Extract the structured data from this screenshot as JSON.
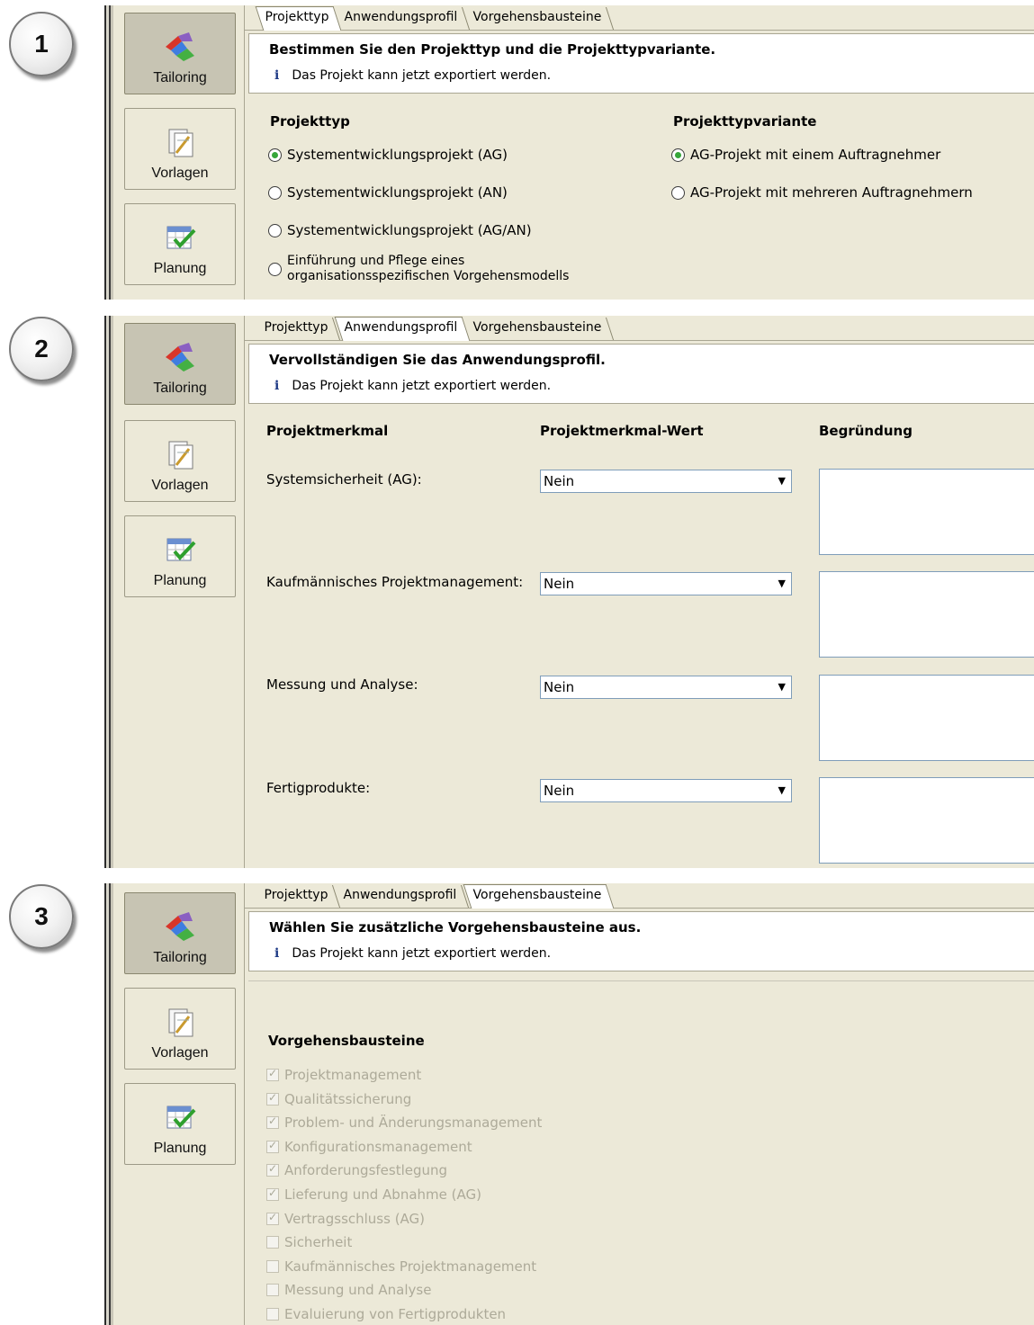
{
  "steps": [
    {
      "number": "1"
    },
    {
      "number": "2"
    },
    {
      "number": "3"
    }
  ],
  "sidebar": {
    "tailoring_label": "Tailoring",
    "vorlagen_label": "Vorlagen",
    "planung_label": "Planung"
  },
  "tabs": [
    "Projekttyp",
    "Anwendungsprofil",
    "Vorgehensbausteine"
  ],
  "info_message": "Das Projekt kann jetzt exportiert werden.",
  "info_icon": "i",
  "panel1": {
    "title": "Bestimmen Sie den Projekttyp und die Projekttypvariante.",
    "projekttyp_heading": "Projekttyp",
    "variante_heading": "Projekttypvariante",
    "projekttyp_options": [
      {
        "label": "Systementwicklungsprojekt (AG)",
        "selected": true
      },
      {
        "label": "Systementwicklungsprojekt (AN)",
        "selected": false
      },
      {
        "label": "Systementwicklungsprojekt (AG/AN)",
        "selected": false
      },
      {
        "label_line1": "Einführung und Pflege eines",
        "label_line2": "organisationsspezifischen Vorgehensmodells",
        "selected": false
      }
    ],
    "variante_options": [
      {
        "label": "AG-Projekt mit einem Auftragnehmer",
        "selected": true
      },
      {
        "label": "AG-Projekt mit mehreren Auftragnehmern",
        "selected": false
      }
    ]
  },
  "panel2": {
    "title": "Vervollständigen Sie das Anwendungsprofil.",
    "col_merkmal": "Projektmerkmal",
    "col_wert": "Projektmerkmal-Wert",
    "col_begruendung": "Begründung",
    "rows": [
      {
        "label": "Systemsicherheit (AG):",
        "value": "Nein"
      },
      {
        "label": "Kaufmännisches Projektmanagement:",
        "value": "Nein"
      },
      {
        "label": "Messung und Analyse:",
        "value": "Nein"
      },
      {
        "label": "Fertigprodukte:",
        "value": "Nein"
      }
    ]
  },
  "panel3": {
    "title": "Wählen Sie zusätzliche Vorgehensbausteine aus.",
    "section_heading": "Vorgehensbausteine",
    "items": [
      {
        "label": "Projektmanagement",
        "checked": true
      },
      {
        "label": "Qualitätssicherung",
        "checked": true
      },
      {
        "label": "Problem- und Änderungsmanagement",
        "checked": true
      },
      {
        "label": "Konfigurationsmanagement",
        "checked": true
      },
      {
        "label": "Anforderungsfestlegung",
        "checked": true
      },
      {
        "label": "Lieferung und Abnahme (AG)",
        "checked": true
      },
      {
        "label": "Vertragsschluss (AG)",
        "checked": true
      },
      {
        "label": "Sicherheit",
        "checked": false
      },
      {
        "label": "Kaufmännisches Projektmanagement",
        "checked": false
      },
      {
        "label": "Messung und Analyse",
        "checked": false
      },
      {
        "label": "Evaluierung von Fertigprodukten",
        "checked": false
      }
    ]
  }
}
